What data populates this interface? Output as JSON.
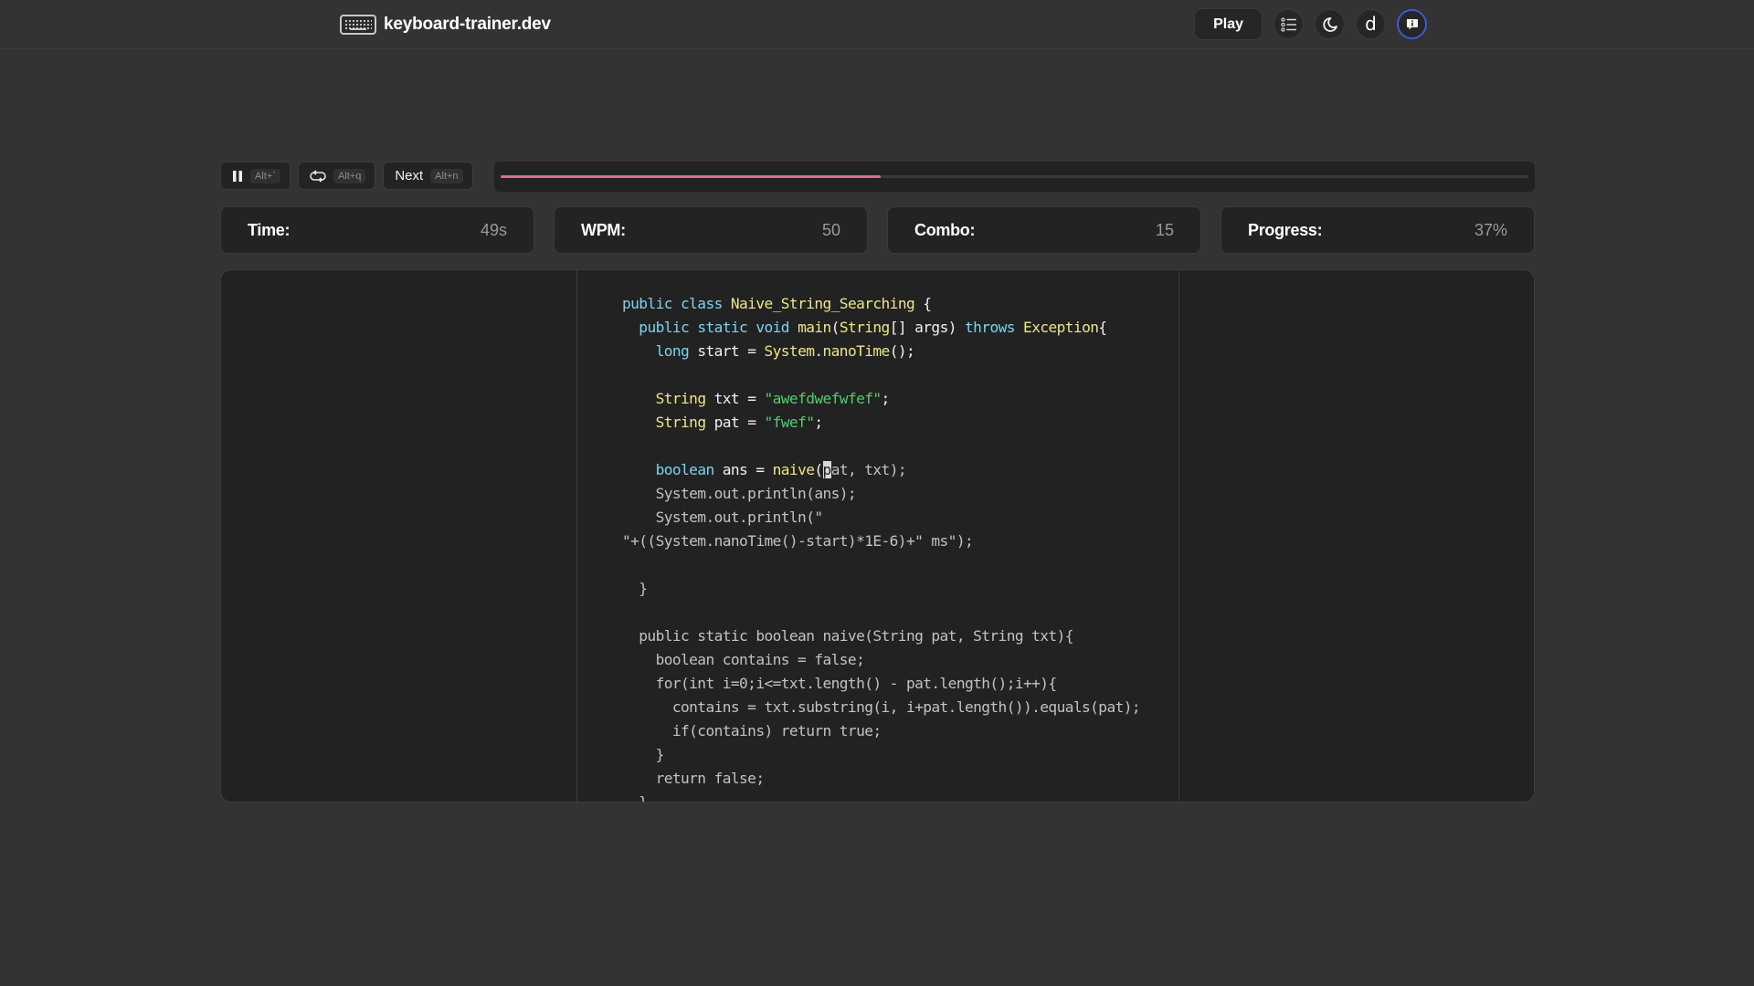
{
  "header": {
    "site_name": "keyboard-trainer.dev",
    "logo_icon": "keyboard-icon",
    "nav": {
      "play_label": "Play",
      "list_icon": "list-icon",
      "theme_icon": "moon-icon",
      "letter_button": "d",
      "info_icon": "info-message-icon"
    }
  },
  "controls": {
    "pause": {
      "icon": "pause-icon",
      "shortcut": "Alt+`"
    },
    "restart": {
      "icon": "repeat-icon",
      "shortcut": "Alt+q"
    },
    "next": {
      "label": "Next",
      "shortcut": "Alt+n"
    },
    "progress_fraction": 0.37,
    "progress_color": "#e06c8c"
  },
  "stats": [
    {
      "label": "Time:",
      "value": "49s"
    },
    {
      "label": "WPM:",
      "value": "50"
    },
    {
      "label": "Combo:",
      "value": "15"
    },
    {
      "label": "Progress:",
      "value": "37%"
    }
  ],
  "colors": {
    "keyword": "#7dd3ee",
    "type": "#ece68a",
    "string": "#4ed06a",
    "typed": "#f0f0f0",
    "pending": "#c2c2c2",
    "accent_ring": "#3a5bd6"
  },
  "code": {
    "caret_line": 7,
    "lines": [
      [
        [
          "kw",
          "public class "
        ],
        [
          "type",
          "Naive_String_Searching"
        ],
        [
          "plain",
          " {"
        ]
      ],
      [
        [
          "plain",
          "  "
        ],
        [
          "kw",
          "public static void "
        ],
        [
          "type",
          "main"
        ],
        [
          "plain",
          "("
        ],
        [
          "type",
          "String"
        ],
        [
          "plain",
          "[] args) "
        ],
        [
          "kw",
          "throws "
        ],
        [
          "type",
          "Exception"
        ],
        [
          "plain",
          "{"
        ]
      ],
      [
        [
          "plain",
          "    "
        ],
        [
          "kw",
          "long "
        ],
        [
          "plain",
          "start = "
        ],
        [
          "type",
          "System.nanoTime"
        ],
        [
          "plain",
          "();"
        ]
      ],
      [
        [
          "plain",
          ""
        ]
      ],
      [
        [
          "plain",
          "    "
        ],
        [
          "type",
          "String "
        ],
        [
          "plain",
          "txt = "
        ],
        [
          "str",
          "\"awefdwefwfef\""
        ],
        [
          "plain",
          ";"
        ]
      ],
      [
        [
          "plain",
          "    "
        ],
        [
          "type",
          "String "
        ],
        [
          "plain",
          "pat = "
        ],
        [
          "str",
          "\"fwef\""
        ],
        [
          "plain",
          ";"
        ]
      ],
      [
        [
          "plain",
          ""
        ]
      ],
      [
        [
          "plain",
          "    "
        ],
        [
          "kw",
          "boolean "
        ],
        [
          "plain",
          "ans = "
        ],
        [
          "type",
          "naive"
        ],
        [
          "plain",
          "("
        ],
        [
          "caret",
          "p"
        ],
        [
          "pending",
          "at, txt);"
        ]
      ],
      [
        [
          "pending",
          "    System.out.println(ans);"
        ]
      ],
      [
        [
          "pending",
          "    System.out.println(\""
        ]
      ],
      [
        [
          "pending",
          "\"+((System.nanoTime()-start)*1E-6)+\" ms\");"
        ]
      ],
      [
        [
          "pending",
          ""
        ]
      ],
      [
        [
          "pending",
          "  }"
        ]
      ],
      [
        [
          "pending",
          ""
        ]
      ],
      [
        [
          "pending",
          "  public static boolean naive(String pat, String txt){"
        ]
      ],
      [
        [
          "pending",
          "    boolean contains = false;"
        ]
      ],
      [
        [
          "pending",
          "    for(int i=0;i<=txt.length() - pat.length();i++){"
        ]
      ],
      [
        [
          "pending",
          "      contains = txt.substring(i, i+pat.length()).equals(pat);"
        ]
      ],
      [
        [
          "pending",
          "      if(contains) return true;"
        ]
      ],
      [
        [
          "pending",
          "    }"
        ]
      ],
      [
        [
          "pending",
          "    return false;"
        ]
      ],
      [
        [
          "pending",
          "  }"
        ]
      ]
    ]
  }
}
